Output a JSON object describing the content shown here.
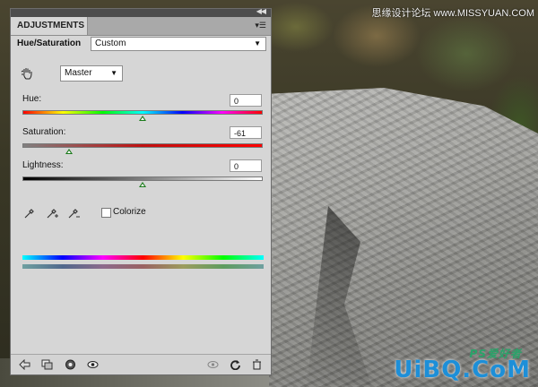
{
  "panel": {
    "tab_label": "ADJUSTMENTS",
    "title": "Hue/Saturation",
    "preset_value": "Custom",
    "channel_value": "Master"
  },
  "hue": {
    "label": "Hue:",
    "value": "0",
    "fraction": 0.5
  },
  "saturation": {
    "label": "Saturation:",
    "value": "-61",
    "fraction": 0.195
  },
  "lightness": {
    "label": "Lightness:",
    "value": "0",
    "fraction": 0.5
  },
  "colorize": {
    "label": "Colorize",
    "checked": false
  },
  "watermark": {
    "top_text": "思缘设计论坛 www.MISSYUAN.COM",
    "bottom_text": "UiBQ.CoM",
    "ps_text": "PS爱好者"
  },
  "colors": {
    "panel_bg": "#d6d6d6",
    "title_bar": "#4d4d4d",
    "thumb": "#1b7a1b"
  }
}
